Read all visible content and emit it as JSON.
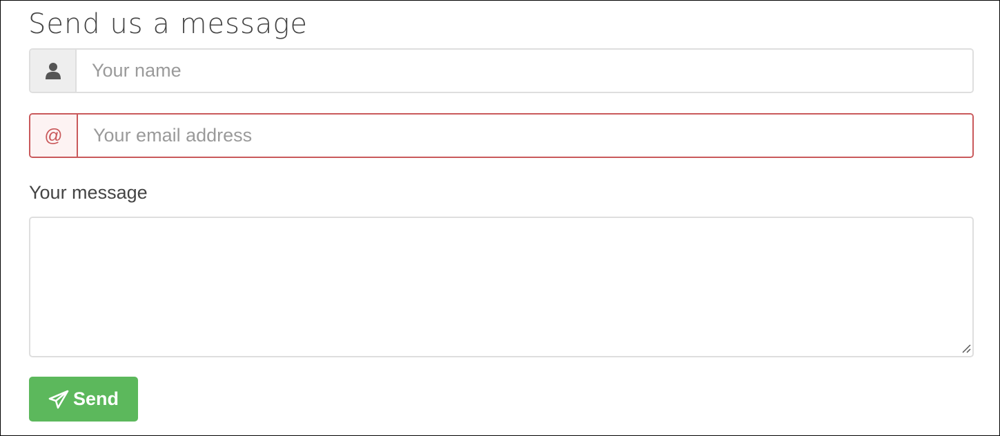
{
  "form": {
    "title": "Send us a message",
    "name": {
      "placeholder": "Your name",
      "value": "",
      "icon": "user-icon"
    },
    "email": {
      "placeholder": "Your email address",
      "value": "",
      "icon": "at-icon",
      "addon_text": "@",
      "state": "error"
    },
    "message": {
      "label": "Your message",
      "value": ""
    },
    "send": {
      "label": "Send",
      "icon": "paper-plane-icon"
    }
  },
  "colors": {
    "error": "#c9585a",
    "success_button": "#5cb85c",
    "border": "#dedede"
  }
}
